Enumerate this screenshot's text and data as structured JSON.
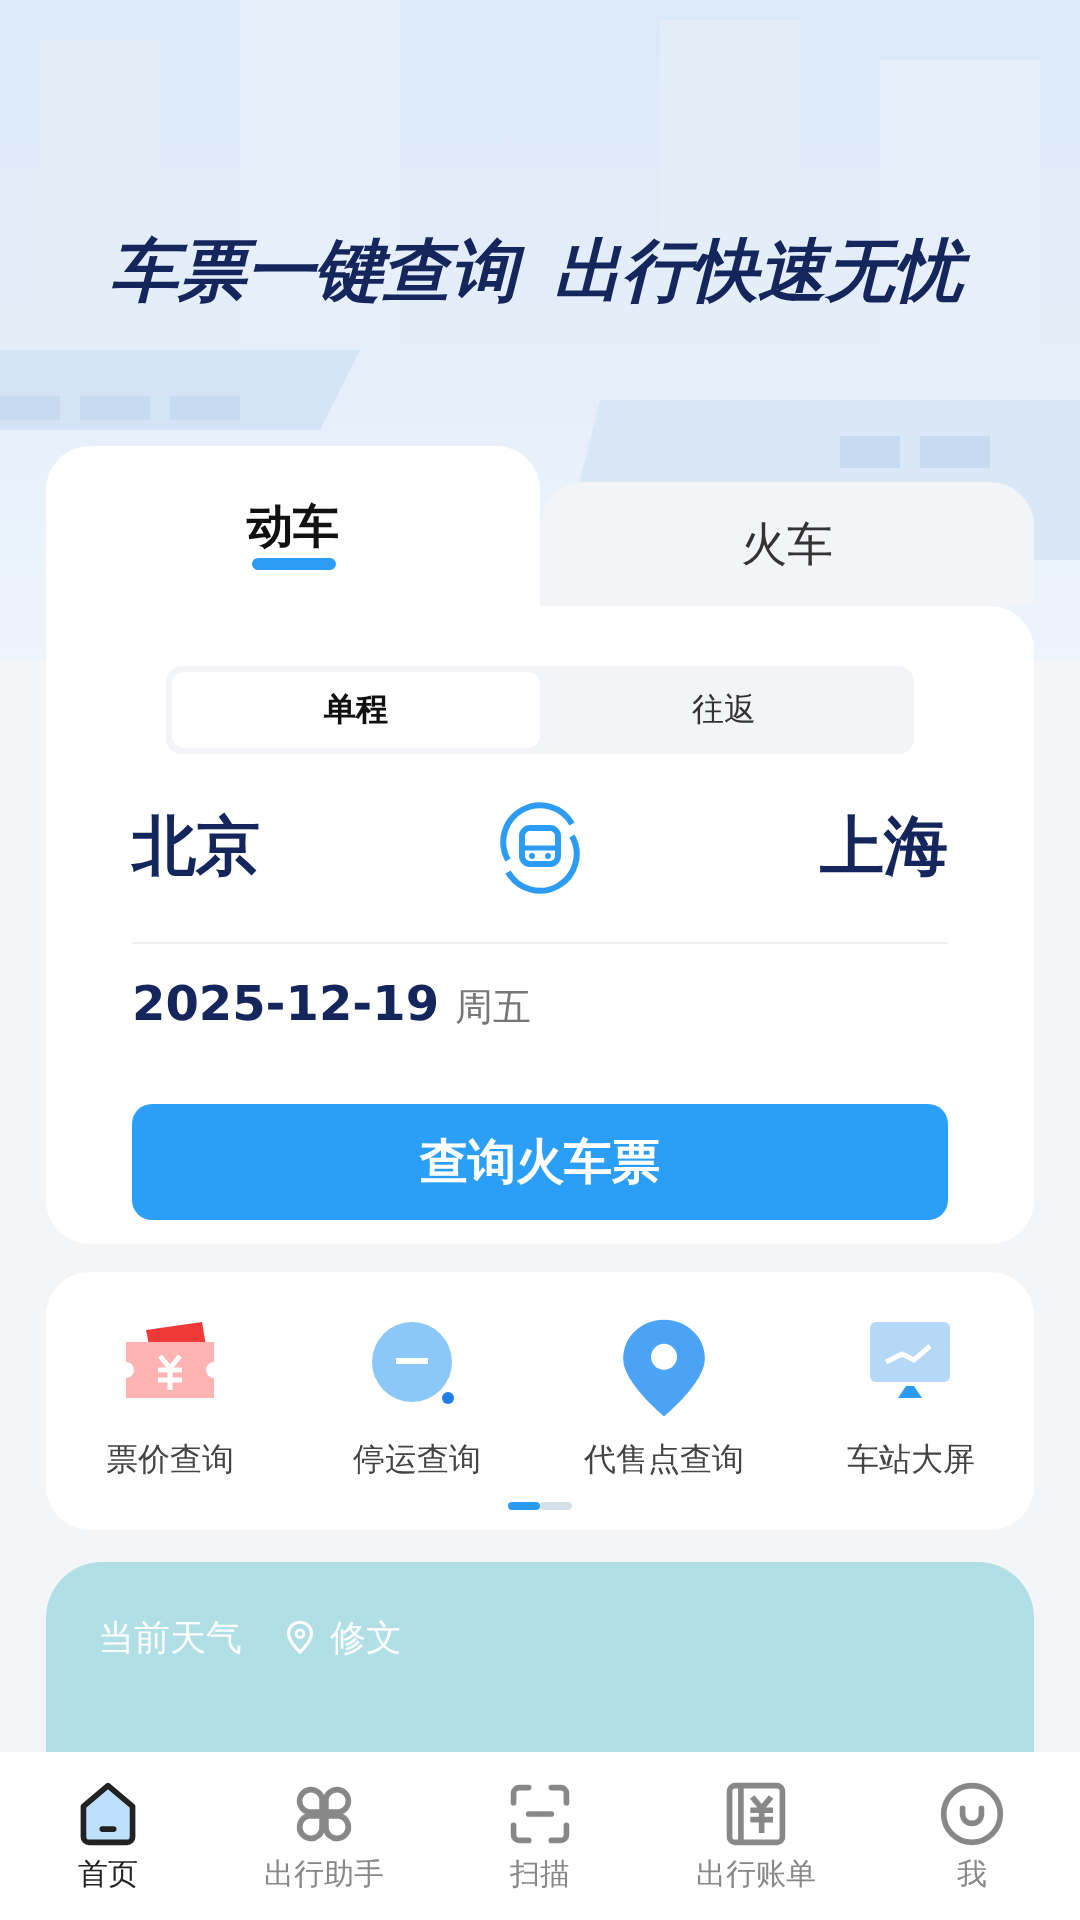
{
  "header": {
    "slogan": [
      "车票一键查询",
      "出行快速无忧"
    ]
  },
  "train_tabs": [
    {
      "label": "动车",
      "selected": true
    },
    {
      "label": "火车",
      "selected": false
    }
  ],
  "trip_types": [
    {
      "label": "单程",
      "selected": true
    },
    {
      "label": "往返",
      "selected": false
    }
  ],
  "route": {
    "from": "北京",
    "to": "上海",
    "date": "2025-12-19",
    "weekday": "周五"
  },
  "search_button": "查询火车票",
  "services": [
    {
      "label": "票价查询",
      "kind": "ticket"
    },
    {
      "label": "停运查询",
      "kind": "search"
    },
    {
      "label": "代售点查询",
      "kind": "pin"
    },
    {
      "label": "车站大屏",
      "kind": "screen"
    }
  ],
  "pager": [
    {
      "selected": true
    },
    {
      "selected": false
    }
  ],
  "weather": {
    "title": "当前天气",
    "location": "修文"
  },
  "nav": [
    {
      "label": "首页",
      "kind": "home",
      "selected": true
    },
    {
      "label": "出行助手",
      "kind": "grid",
      "selected": false
    },
    {
      "label": "扫描",
      "kind": "scan",
      "selected": false
    },
    {
      "label": "出行账单",
      "kind": "bill",
      "selected": false
    },
    {
      "label": "我",
      "kind": "me",
      "selected": false
    }
  ]
}
